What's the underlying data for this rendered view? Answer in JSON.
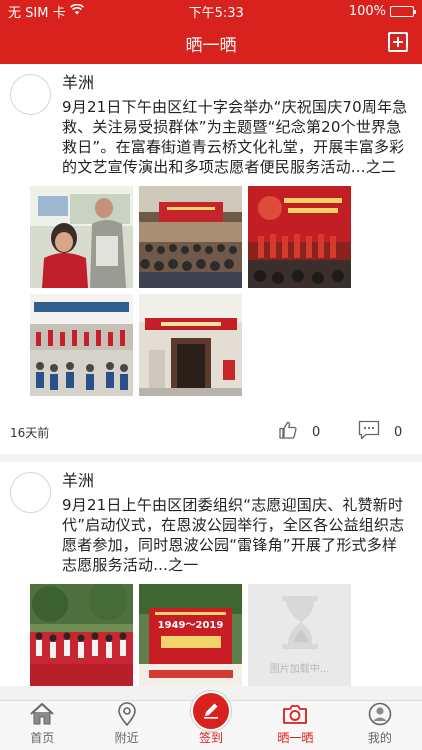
{
  "status_bar": {
    "carrier": "无 SIM 卡",
    "time": "下午5:33",
    "battery": "100%"
  },
  "nav": {
    "title": "晒一晒"
  },
  "posts": [
    {
      "author": "羊洲",
      "text": "9月21日下午由区红十字会举办“庆祝国庆70周年急救、关注易受损群体”为主题暨“纪念第20个世界急救日”。在富春街道青云桥文化礼堂，开展丰富多彩的文艺宣传演出和多项志愿者便民服务活动...之二",
      "time": "16天前",
      "likes": "0",
      "comments": "0"
    },
    {
      "author": "羊洲",
      "text": "9月21日上午由区团委组织“志愿迎国庆、礼赞新时代”启动仪式，在恩波公园举行，全区各公益组织志愿者参加，同时恩波公园“雷锋角”开展了形式多样志愿服务活动...之一",
      "image_loading_text": "图片加载中...",
      "image_caption_year": "1949～2019"
    }
  ],
  "tabs": [
    {
      "label": "首页"
    },
    {
      "label": "附近"
    },
    {
      "label": "签到"
    },
    {
      "label": "晒一晒"
    },
    {
      "label": "我的"
    }
  ],
  "colors": {
    "brand": "#d9211d",
    "tab_inactive": "#666666"
  }
}
